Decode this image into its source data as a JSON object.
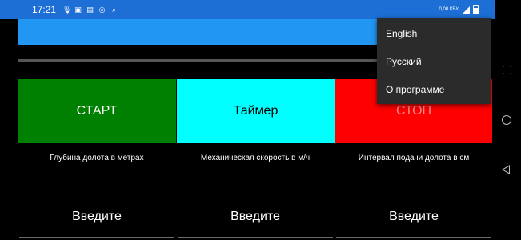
{
  "status_bar": {
    "time": "17:21",
    "left_icons": [
      "mic-icon",
      "image-icon",
      "cast-icon",
      "vpn-icon",
      "search-icon"
    ],
    "network_speed": "0,00 КБ/с",
    "right_icons": [
      "signal-icon",
      "battery-icon"
    ]
  },
  "buttons": {
    "start": "СТАРТ",
    "timer": "Таймер",
    "stop": "СТОП"
  },
  "labels": {
    "depth": "Глубина долота в метрах",
    "speed": "Механическая скорость в м/ч",
    "interval": "Интервал подачи долота в см"
  },
  "inputs": {
    "depth_placeholder": "Введите",
    "speed_placeholder": "Введите",
    "interval_placeholder": "Введите"
  },
  "menu": {
    "items": [
      "English",
      "Русский",
      "О программе"
    ]
  },
  "colors": {
    "status_bar": "#1d6fd6",
    "app_bar": "#2196f3",
    "start": "#008000",
    "timer": "#00ffff",
    "stop": "#ff0000",
    "menu_bg": "#2b2b2b"
  }
}
